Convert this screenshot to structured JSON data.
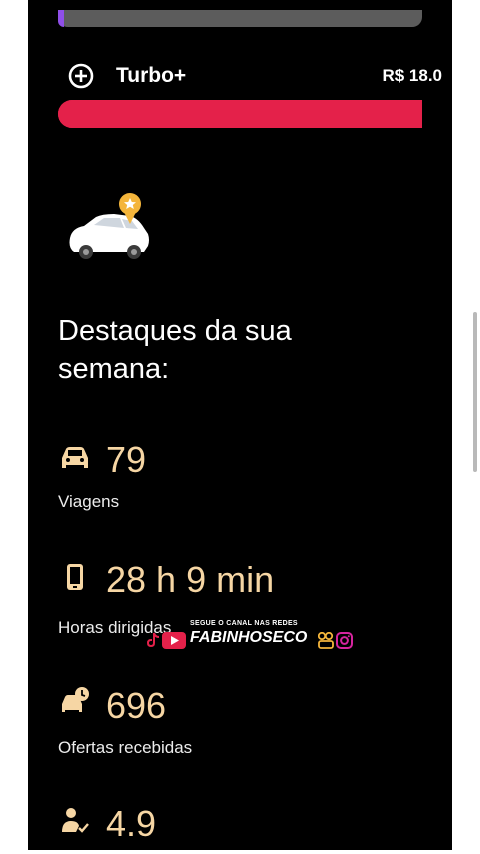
{
  "progress_bars": {
    "top_fill_fraction": 0.01,
    "top_fill_color": "#8f4fe8",
    "turbo_fill_fraction": 1.0,
    "turbo_fill_color": "#e4214a"
  },
  "turbo": {
    "label": "Turbo+",
    "value": "R$ 18.0",
    "icon": "plus-circle-icon"
  },
  "illustration": {
    "icon": "car-with-star-badge"
  },
  "highlights": {
    "title": "Destaques da sua semana:",
    "stats": [
      {
        "icon": "car-icon",
        "value": "79",
        "label": "Viagens"
      },
      {
        "icon": "phone-icon",
        "value": "28 h 9 min",
        "label": "Horas dirigidas"
      },
      {
        "icon": "offers-icon",
        "value": "696",
        "label": "Ofertas recebidas"
      },
      {
        "icon": "rating-user-icon",
        "value": "4.9",
        "label": ""
      }
    ]
  },
  "watermark": {
    "top_text": "SEGUE O CANAL NAS REDES",
    "name": "FABINHOSECO"
  },
  "colors": {
    "background": "#000000",
    "stat_value": "#f6d6a4",
    "accent_red": "#e4214a"
  }
}
